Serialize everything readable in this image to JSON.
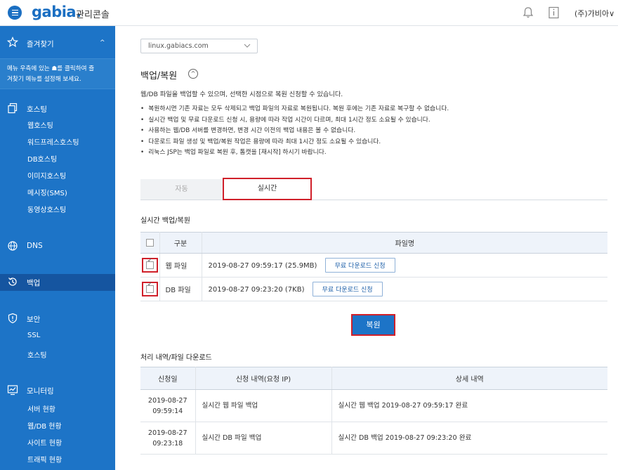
{
  "header": {
    "logo": "gabia.",
    "title": "관리콘솔",
    "user": "(주)가비아",
    "user_chevron": "∨"
  },
  "sidebar": {
    "favorites": {
      "label": "즐겨찾기",
      "chevron": "^",
      "desc_line1": "메뉴 우측에 있는 ☗를 클릭하여 즐",
      "desc_line2": "겨찾기 메뉴를 설정해 보세요."
    },
    "hosting": {
      "label": "호스팅",
      "items": [
        "웹호스팅",
        "워드프레스호스팅",
        "DB호스팅",
        "이미지호스팅",
        "메시징(SMS)",
        "동영상호스팅"
      ]
    },
    "dns": {
      "label": "DNS"
    },
    "backup": {
      "label": "백업"
    },
    "security": {
      "label": "보안",
      "items": [
        "SSL",
        "호스팅"
      ]
    },
    "monitoring": {
      "label": "모니터링",
      "items": [
        "서버 현황",
        "웹/DB 현황",
        "사이트 현황",
        "트래픽 현황"
      ]
    }
  },
  "main": {
    "domain_value": "linux.gabiacs.com",
    "title": "백업/복원",
    "collapse_glyph": "^",
    "intro": "웹/DB 파일을 백업할 수 있으며, 선택한 시점으로 복원 신청할 수 있습니다.",
    "notes": [
      "복원하시면 기존 자료는 모두 삭제되고 백업 파일의 자료로 복원됩니다. 복원 후에는 기존 자료로 복구할 수 없습니다.",
      "실시간 백업 및 무료 다운로드 신청 시, 용량에 따라 작업 시간이 다르며, 최대 1시간 정도 소요될 수 있습니다.",
      "사용하는 웹/DB 서버를 변경하면, 변경 시간 이전의 백업 내용은 볼 수 없습니다.",
      "다운로드 파일 생성 및 백업/복원 작업은 용량에 따라 최대 1시간 정도 소요될 수 있습니다.",
      "리눅스 JSP는 백업 파일로 복원 후, 톰캣을 [재시작] 하시기 바랍니다."
    ],
    "tabs": {
      "auto": "자동",
      "live": "실시간"
    },
    "live_section_title": "실시간 백업/복원",
    "files_table": {
      "headers": {
        "type": "구분",
        "filename": "파일명"
      },
      "rows": [
        {
          "type": "웹 파일",
          "file": "2019-08-27 09:59:17 (25.9MB)",
          "button": "무료 다운로드 신청",
          "checked": true
        },
        {
          "type": "DB 파일",
          "file": "2019-08-27 09:23:20 (7KB)",
          "button": "무료 다운로드 신청",
          "checked": true
        }
      ]
    },
    "restore_button": "복원",
    "history_title": "처리 내역/파일 다운로드",
    "history_table": {
      "headers": {
        "date": "신청일",
        "request": "신청 내역(요청 IP)",
        "detail": "상세 내역"
      },
      "rows": [
        {
          "date_line1": "2019-08-27",
          "date_line2": "09:59:14",
          "request": "실시간 웹 파일 백업",
          "detail": "실시간 웹 백업 2019-08-27 09:59:17 완료"
        },
        {
          "date_line1": "2019-08-27",
          "date_line2": "09:23:18",
          "request": "실시간 DB 파일 백업",
          "detail": "실시간 DB 백업 2019-08-27 09:23:20 완료"
        }
      ]
    }
  },
  "colors": {
    "brand": "#1d74c7",
    "highlight": "#d0202a",
    "sidebar_active": "#1555a0"
  }
}
